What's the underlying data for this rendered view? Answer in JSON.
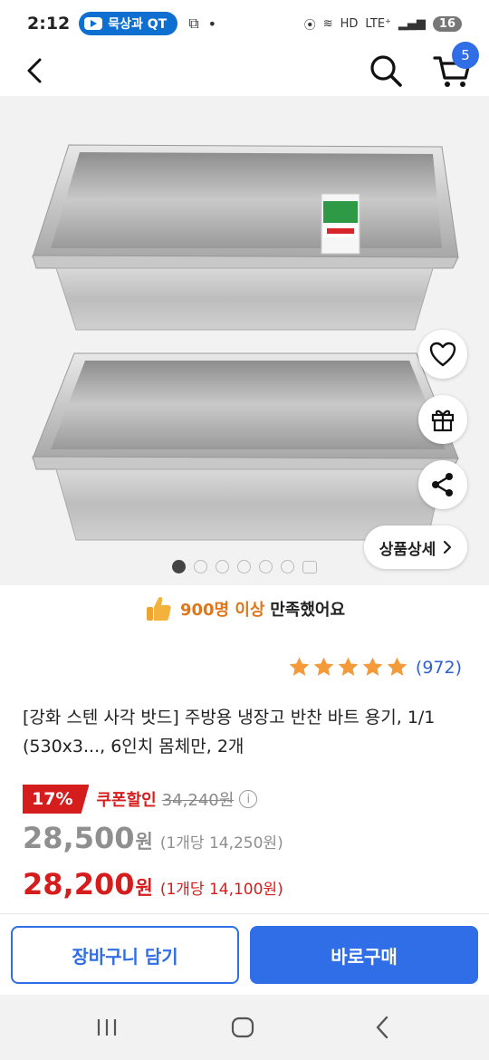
{
  "status_bar": {
    "time": "2:12",
    "pill_label": "묵상과 QT",
    "network": "LTE⁺",
    "battery": "16"
  },
  "header": {
    "cart_count": "5"
  },
  "gallery": {
    "detail_button_label": "상품상세",
    "dot_count": 6,
    "active_index": 0
  },
  "satisfaction": {
    "highlight": "900명 이상",
    "rest": "만족했어요"
  },
  "rating": {
    "stars": 5,
    "review_count": "(972)"
  },
  "product": {
    "title": "[강화 스텐 사각 밧드] 주방용 냉장고 반찬 바트 용기, 1/1 (530x3..., 6인치 몸체만, 2개"
  },
  "pricing": {
    "discount_rate": "17%",
    "coupon_label": "쿠폰할인",
    "original_price": "34,240원",
    "price": "28,500",
    "price_unit": "원",
    "unit_price": "(1개당 14,250원)",
    "coupon_price": "28,200",
    "coupon_price_unit": "원",
    "coupon_unit_price": "(1개당 14,100원)"
  },
  "actions": {
    "add_to_cart": "장바구니 담기",
    "buy_now": "바로구매"
  },
  "colors": {
    "brand_blue": "#2f6ee6",
    "discount_red": "#d51d1d",
    "satisfaction_orange": "#e0761a",
    "star_orange": "#f39a3a"
  },
  "icons": [
    "back-arrow-icon",
    "search-icon",
    "cart-icon",
    "heart-icon",
    "gift-icon",
    "share-icon",
    "chevron-right-icon",
    "thumbs-up-icon",
    "star-icon",
    "info-icon"
  ]
}
